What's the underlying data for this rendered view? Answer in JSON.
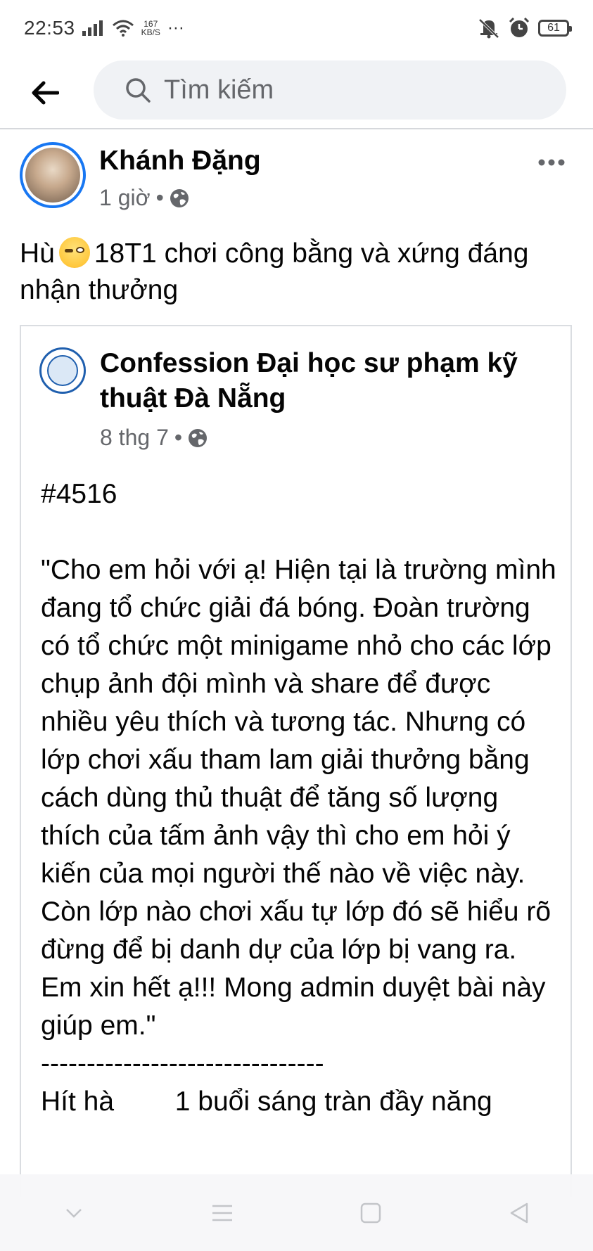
{
  "status_bar": {
    "time": "22:53",
    "network_speed_value": "167",
    "network_speed_unit": "KB/S",
    "more": "···",
    "battery": "61",
    "icons": [
      "signal-icon",
      "wifi-icon",
      "mute-icon",
      "alarm-icon",
      "battery-icon"
    ]
  },
  "top_bar": {
    "search_placeholder": "Tìm kiếm",
    "icons": [
      "back-arrow-icon",
      "search-icon"
    ]
  },
  "post": {
    "author": "Khánh Đặng",
    "time": "1 giờ",
    "separator": "•",
    "audience_icon": "globe-icon",
    "more_icon": "more-options-icon",
    "text_before_emoji": "Hù",
    "emoji": "face-with-rolling-eyes-emoji",
    "text_after_emoji": "18T1 chơi công bằng và xứng đáng nhận thưởng"
  },
  "shared_post": {
    "page_name": "Confession Đại học sư phạm kỹ thuật Đà Nẵng",
    "date": "8 thg 7",
    "separator": "•",
    "audience_icon": "globe-icon",
    "body": "#4516\n\n\"Cho em hỏi với ạ! Hiện tại là trường mình đang tổ chức giải đá bóng. Đoàn trường có tổ chức một minigame nhỏ cho các lớp chụp ảnh đội mình và share để được nhiều yêu thích và tương tác. Nhưng có lớp chơi xấu tham lam giải thưởng bằng cách dùng thủ thuật để tăng số lượng thích của tấm ảnh vậy thì cho em hỏi ý kiến của mọi người thế nào về việc này.\nCòn lớp nào chơi xấu tự lớp đó sẽ hiểu rõ đừng để bị danh dự của lớp bị vang ra.\nEm xin hết ạ!!! Mong admin duyệt bài này giúp em.\"\n-------------------------------\nHít hà        1 buổi sáng tràn đầy năng"
  },
  "nav_bar": {
    "icons": [
      "chevron-down-icon",
      "menu-icon",
      "home-square-icon",
      "back-triangle-icon"
    ]
  },
  "colors": {
    "accent": "#1877f2",
    "text": "#050505",
    "secondary_text": "#65676b",
    "search_bg": "#f0f2f5",
    "divider": "#dadde1"
  }
}
